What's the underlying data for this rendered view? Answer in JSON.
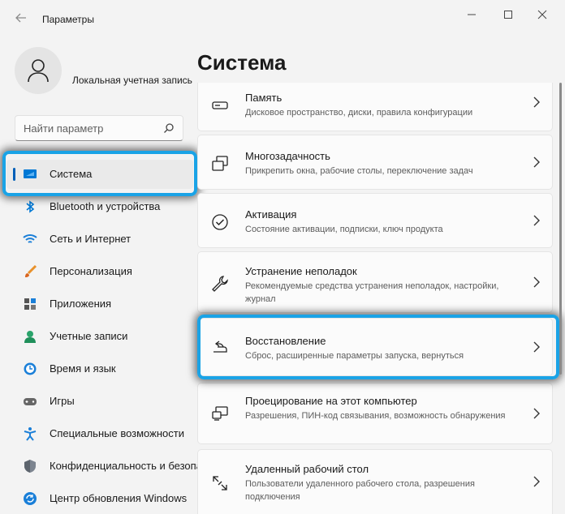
{
  "window": {
    "title": "Параметры",
    "controls": [
      "minimize-icon",
      "maximize-icon",
      "close-icon"
    ]
  },
  "account": {
    "name": "Локальная учетная запись"
  },
  "search": {
    "placeholder": "Найти параметр"
  },
  "sidebar": {
    "items": [
      {
        "label": "Система",
        "icon": "system-icon",
        "active": true
      },
      {
        "label": "Bluetooth и устройства",
        "icon": "bluetooth-icon"
      },
      {
        "label": "Сеть и Интернет",
        "icon": "network-icon"
      },
      {
        "label": "Персонализация",
        "icon": "brush-icon"
      },
      {
        "label": "Приложения",
        "icon": "apps-icon"
      },
      {
        "label": "Учетные записи",
        "icon": "account-icon"
      },
      {
        "label": "Время и язык",
        "icon": "time-language-icon"
      },
      {
        "label": "Игры",
        "icon": "gaming-icon"
      },
      {
        "label": "Специальные возможности",
        "icon": "accessibility-icon"
      },
      {
        "label": "Конфиденциальность и безопасность",
        "icon": "shield-icon"
      },
      {
        "label": "Центр обновления Windows",
        "icon": "update-icon"
      }
    ]
  },
  "main": {
    "title": "Система",
    "cards": [
      {
        "title": "Память",
        "desc": "Дисковое пространство, диски, правила конфигурации",
        "icon": "storage-icon"
      },
      {
        "title": "Многозадачность",
        "desc": "Прикрепить окна, рабочие столы, переключение задач",
        "icon": "multitasking-icon"
      },
      {
        "title": "Активация",
        "desc": "Состояние активации, подписки, ключ продукта",
        "icon": "activation-icon"
      },
      {
        "title": "Устранение неполадок",
        "desc": "Рекомендуемые средства устранения неполадок, настройки, журнал",
        "icon": "troubleshoot-icon"
      },
      {
        "title": "Восстановление",
        "desc": "Сброс, расширенные параметры запуска, вернуться",
        "icon": "recovery-icon"
      },
      {
        "title": "Проецирование на этот компьютер",
        "desc": "Разрешения, ПИН-код связывания, возможность обнаружения",
        "icon": "projection-icon"
      },
      {
        "title": "Удаленный рабочий стол",
        "desc": "Пользователи удаленного рабочего стола, разрешения подключения",
        "icon": "remote-desktop-icon"
      }
    ]
  },
  "colors": {
    "accent": "#005fb8",
    "highlight": "#1aa3e6"
  }
}
